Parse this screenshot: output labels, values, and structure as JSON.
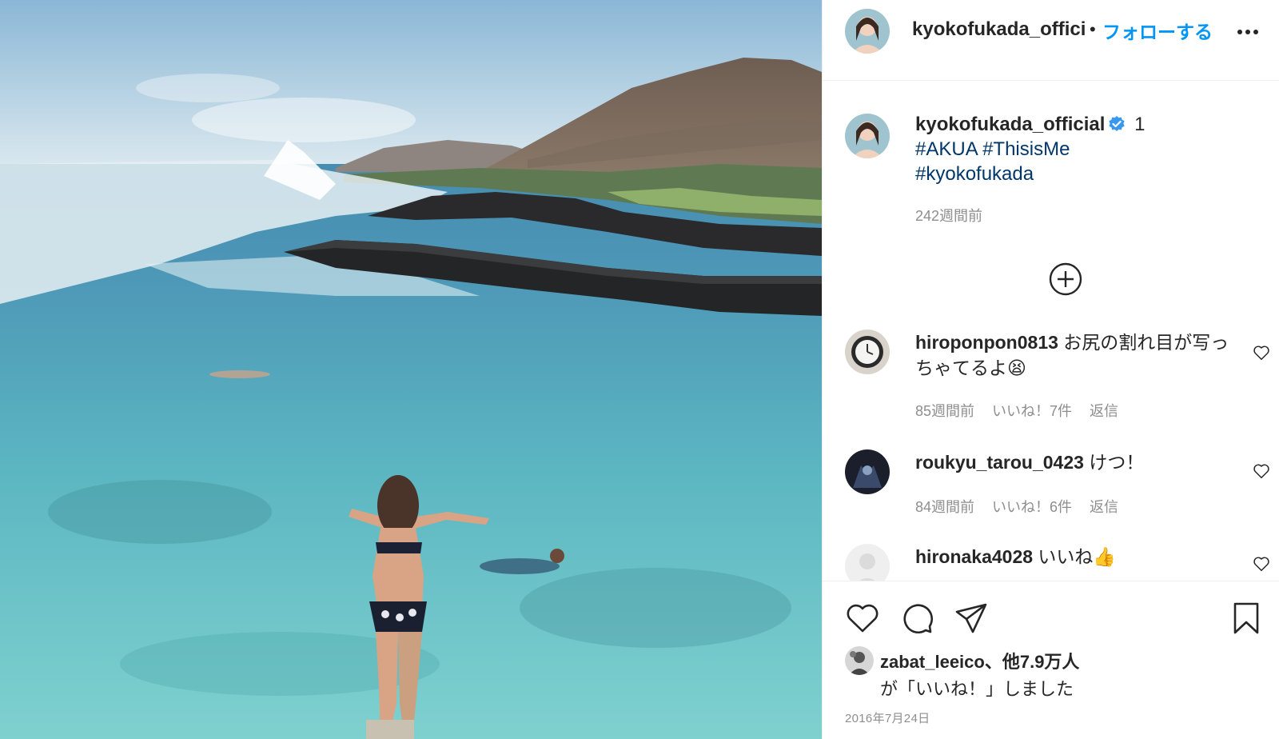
{
  "post": {
    "image_alt": "woman diving from rock into turquoise ocean with mountains",
    "header": {
      "username": "kyokofukada_official",
      "separator": "•",
      "follow_label": "フォローする",
      "more_icon": "more-dots-icon"
    },
    "caption": {
      "username": "kyokofukada_official",
      "verified_icon": "verified-badge-icon",
      "leading_text": "1",
      "hashtags": [
        "#AKUA",
        "#ThisisMe",
        "#kyokofukada"
      ],
      "time": "242週間前"
    },
    "load_more_icon": "plus-circle-icon",
    "comments": [
      {
        "username": "hiroponpon0813",
        "text": "お尻の割れ目が写っちゃてるよ😫",
        "time": "85週間前",
        "likes": "いいね！7件",
        "reply": "返信"
      },
      {
        "username": "roukyu_tarou_0423",
        "text": "けつ！",
        "time": "84週間前",
        "likes": "いいね！6件",
        "reply": "返信"
      },
      {
        "username": "hironaka4028",
        "text": "いいね👍",
        "time": "",
        "likes": "",
        "reply": ""
      }
    ],
    "actions": {
      "like_icon": "heart-outline-icon",
      "comment_icon": "comment-bubble-icon",
      "share_icon": "paper-plane-icon",
      "save_icon": "bookmark-icon"
    },
    "likes": {
      "first_user": "zabat_leeico",
      "others": "、他7.9万人",
      "suffix": "が「いいね！」しました"
    },
    "date": "2016年7月24日"
  },
  "colors": {
    "link_blue": "#0095f6",
    "hashtag": "#00376b",
    "secondary_text": "#8e8e8e",
    "primary_text": "#262626",
    "border": "#efefef"
  }
}
